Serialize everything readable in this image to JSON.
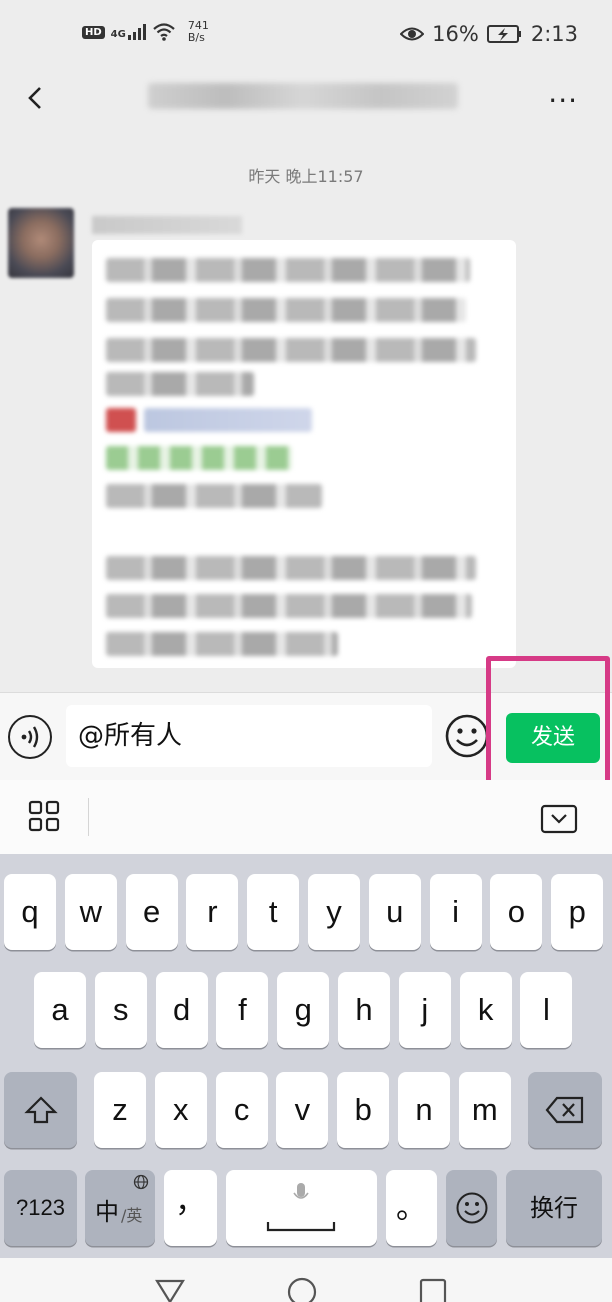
{
  "status_bar": {
    "hd_label": "HD",
    "signal_label": "4G",
    "net_speed_value": "741",
    "net_speed_unit": "B/s",
    "battery": "16%",
    "time": "2:13"
  },
  "header": {
    "more_label": "···"
  },
  "chat": {
    "timestamp": "昨天 晚上11:57"
  },
  "input": {
    "text": "@所有人",
    "send_label": "发送",
    "accent": "#07c160",
    "highlight_color": "#d63a86"
  },
  "keyboard": {
    "row1": [
      "q",
      "w",
      "e",
      "r",
      "t",
      "y",
      "u",
      "i",
      "o",
      "p"
    ],
    "row2": [
      "a",
      "s",
      "d",
      "f",
      "g",
      "h",
      "j",
      "k",
      "l"
    ],
    "row3": [
      "z",
      "x",
      "c",
      "v",
      "b",
      "n",
      "m"
    ],
    "num_label": "?123",
    "lang_main": "中",
    "lang_sub": "/英",
    "comma": "，",
    "period": "。",
    "enter_label": "换行"
  }
}
